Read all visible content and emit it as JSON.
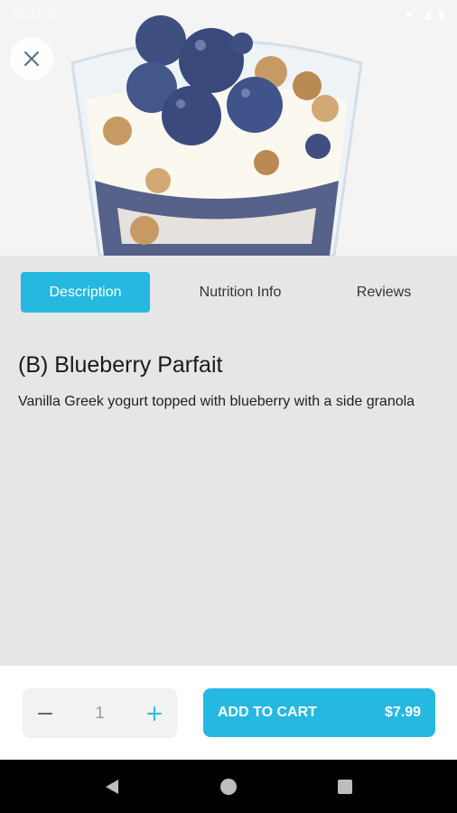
{
  "status_bar": {
    "time": "10:37"
  },
  "hero": {
    "image_desc": "blueberry parfait in glass"
  },
  "close_button": {
    "icon": "close-icon"
  },
  "tabs": [
    {
      "label": "Description",
      "active": true
    },
    {
      "label": "Nutrition Info",
      "active": false
    },
    {
      "label": "Reviews",
      "active": false
    }
  ],
  "product": {
    "title": "(B) Blueberry Parfait",
    "description": "Vanilla Greek yogurt topped with blueberry with a side granola"
  },
  "cart": {
    "quantity": "1",
    "add_label": "ADD TO CART",
    "price": "$7.99"
  },
  "colors": {
    "accent": "#25b8e0",
    "background": "#e6e6e6"
  }
}
